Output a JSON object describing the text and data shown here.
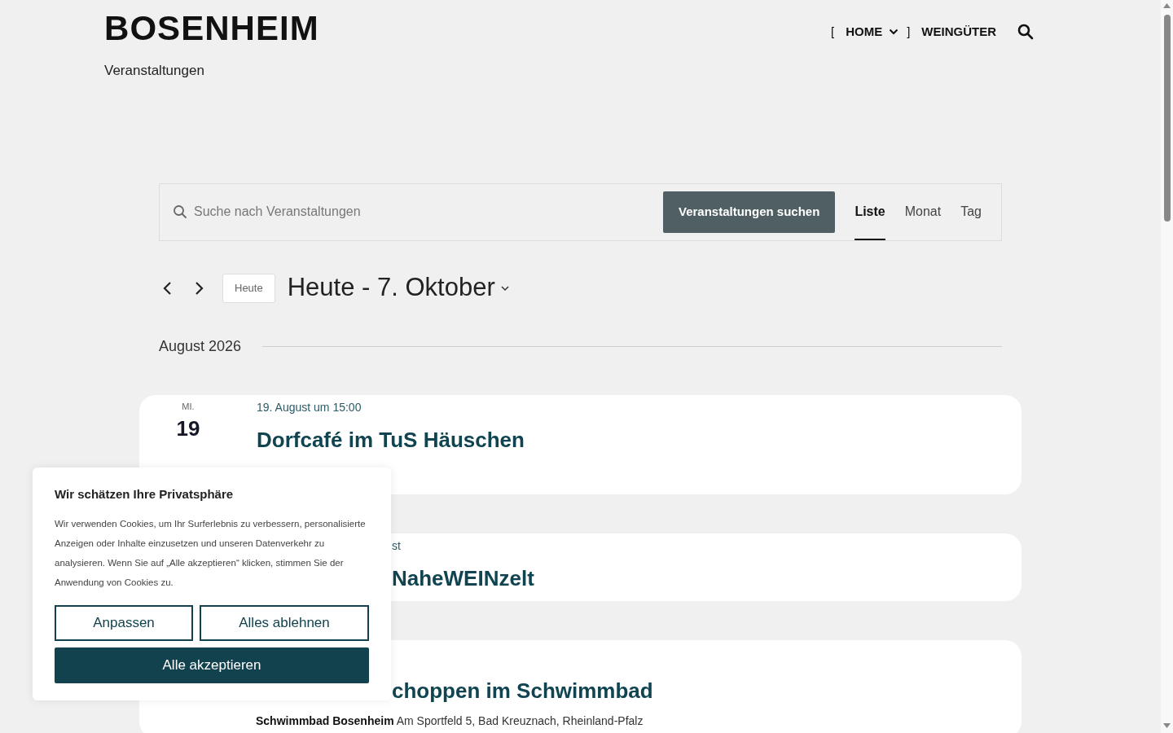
{
  "site": {
    "title": "BOSENHEIM",
    "tagline": "Veranstaltungen"
  },
  "nav": [
    {
      "label": "HOME",
      "kind": "dropdown",
      "bracket_open": "[",
      "bracket_close": "]"
    },
    {
      "label": "WEINGÜTER",
      "kind": "link"
    }
  ],
  "search": {
    "placeholder": "Suche nach Veranstaltungen",
    "button": "Veranstaltungen suchen"
  },
  "views": [
    {
      "label": "Liste",
      "selected": true
    },
    {
      "label": "Monat",
      "selected": false
    },
    {
      "label": "Tag",
      "selected": false
    }
  ],
  "date_nav": {
    "today_button": "Heute",
    "range": "Heute - 7. Oktober"
  },
  "month_separator": "August 2026",
  "events": [
    {
      "covered": false,
      "weekday": "MI.",
      "day": "19",
      "datetime": "19. August um 15:00",
      "title": "Dorfcafé im TuS Häuschen"
    },
    {
      "covered": true,
      "datetime": "st",
      "title": "NaheWEINzelt"
    },
    {
      "covered": true,
      "title": "choppen im Schwimmbad",
      "venue_name": "Schwimmbad Bosenheim",
      "venue_address": "Am Sportfeld 5, Bad Kreuznach, Rheinland-Pfalz"
    }
  ],
  "cookie_dialog": {
    "title": "Wir schätzen Ihre Privatsphäre",
    "text": "Wir verwenden Cookies, um Ihr Surferlebnis zu verbessern, personalisierte Anzeigen oder Inhalte einzusetzen und unseren Datenverkehr zu analysieren. Wenn Sie auf „Alle akzeptieren“ klicken, stimmen Sie der Anwendung von Cookies zu.",
    "buttons": [
      {
        "label": "Anpassen",
        "kind": "outline"
      },
      {
        "label": "Alles ablehnen",
        "kind": "outline"
      },
      {
        "label": "Alle akzeptieren",
        "kind": "primary"
      }
    ]
  }
}
